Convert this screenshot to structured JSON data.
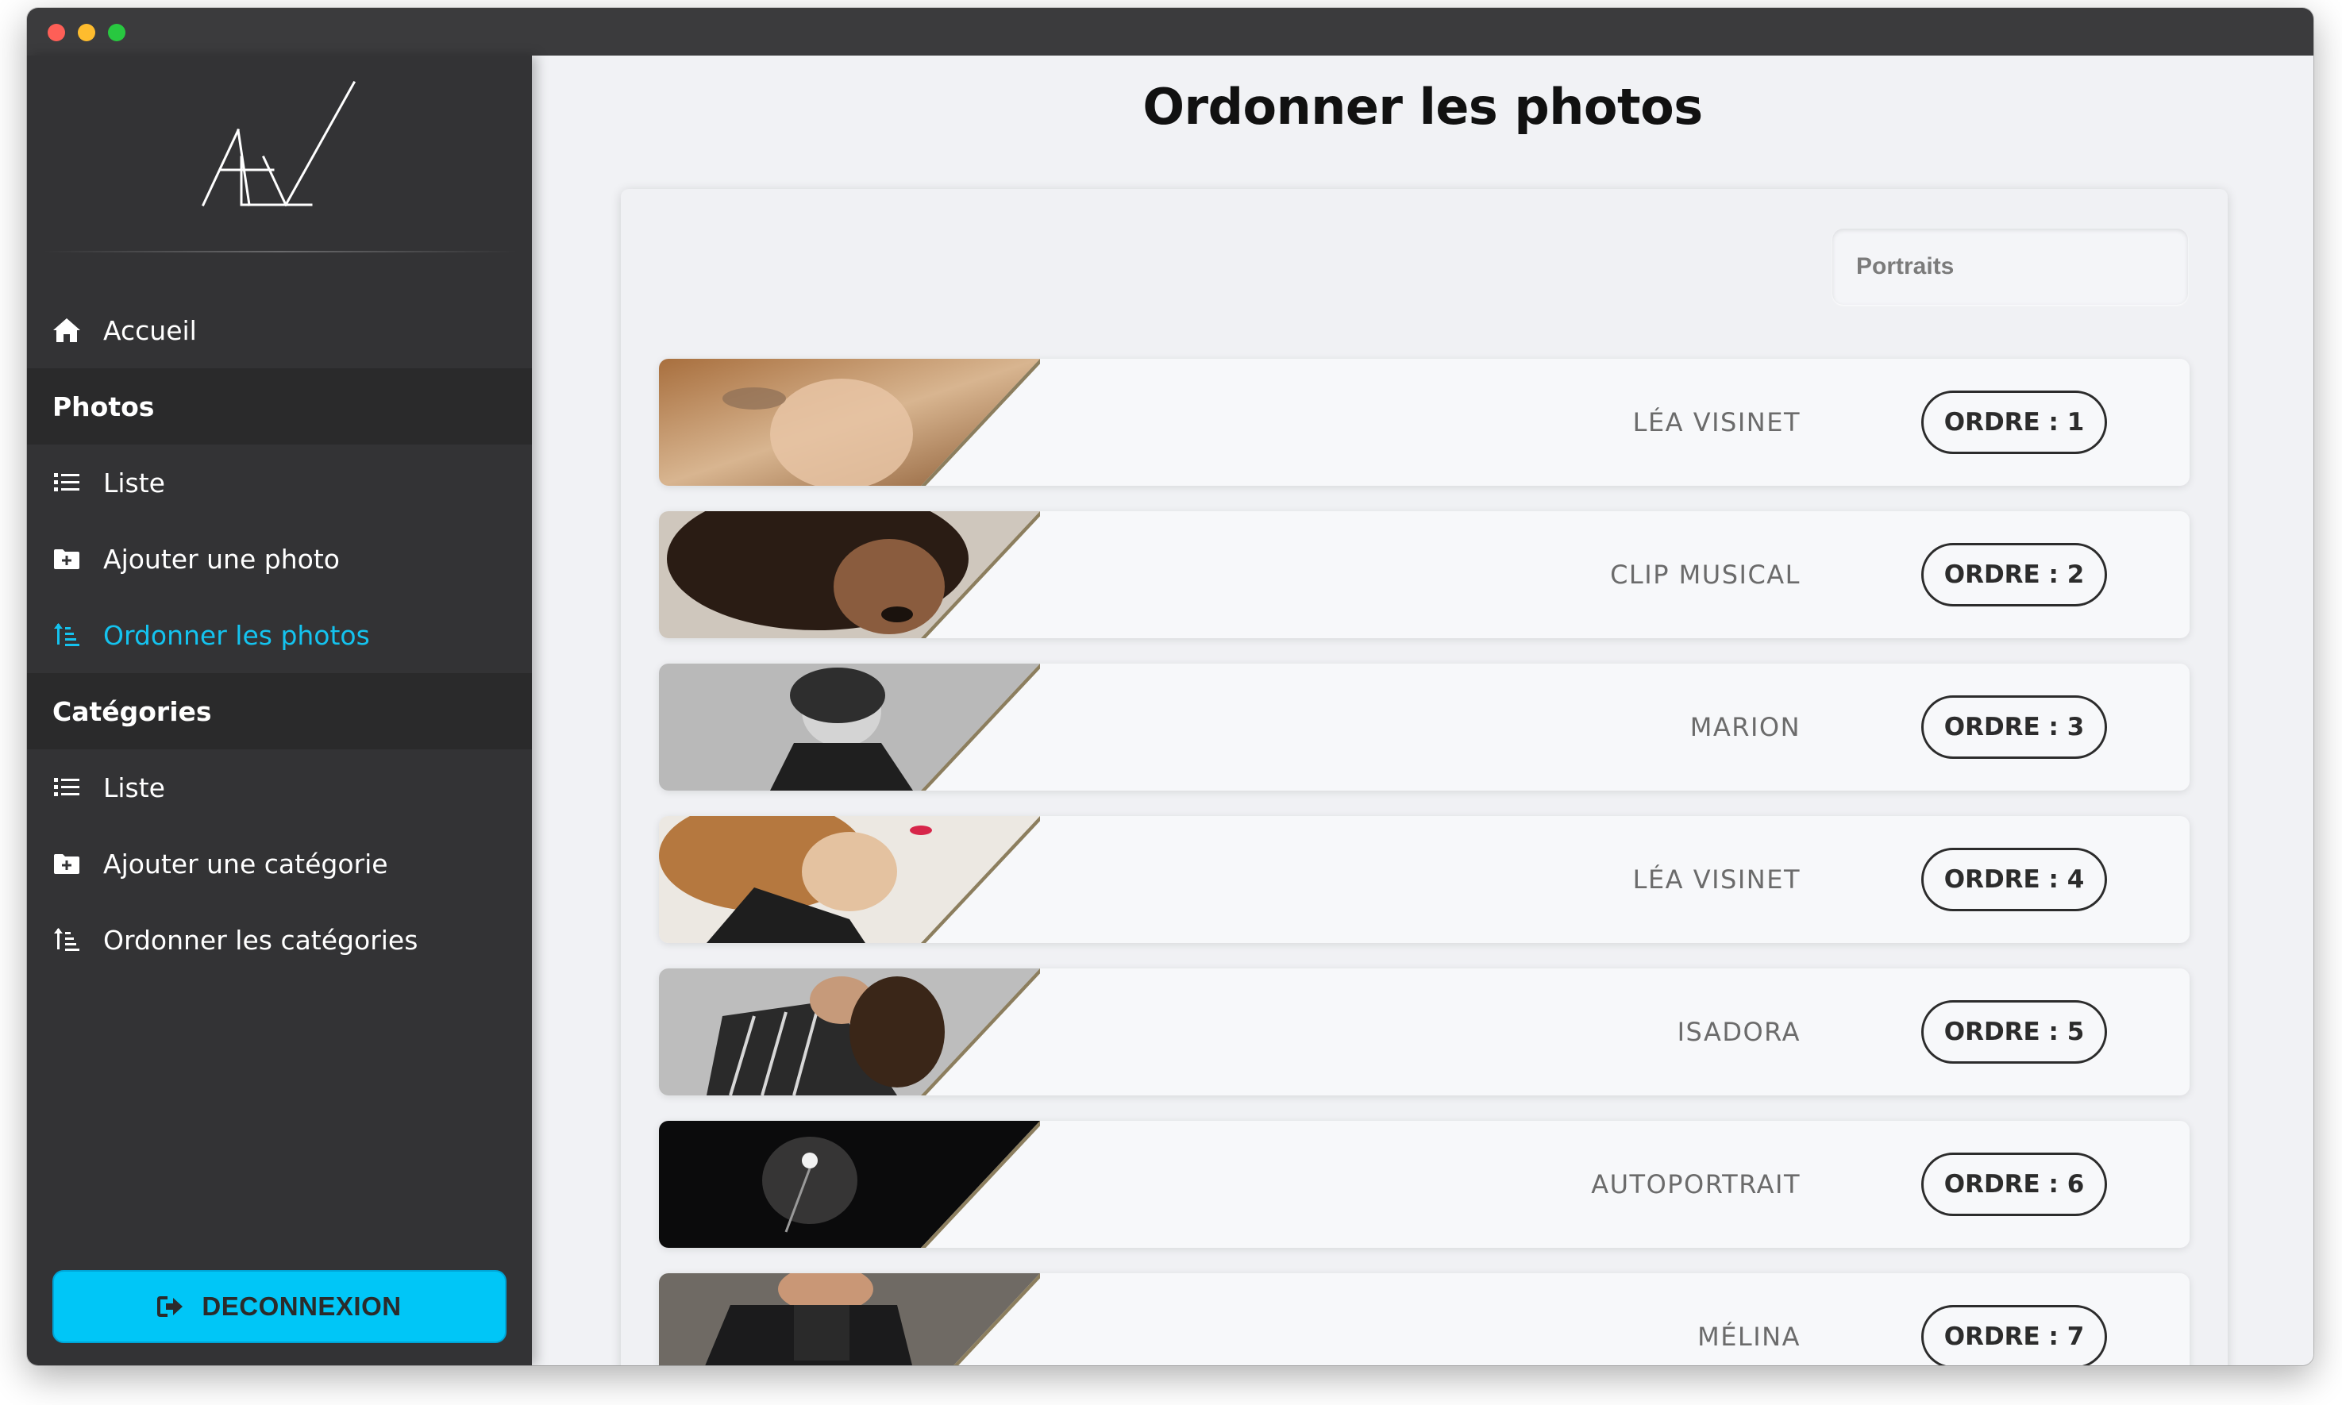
{
  "sidebar": {
    "nav": {
      "accueil": "Accueil",
      "photos_header": "Photos",
      "photos_liste": "Liste",
      "photos_ajouter": "Ajouter une photo",
      "photos_ordonner": "Ordonner les photos",
      "categories_header": "Catégories",
      "categories_liste": "Liste",
      "categories_ajouter": "Ajouter une catégorie",
      "categories_ordonner": "Ordonner les catégories"
    },
    "active_item": "Ordonner les photos",
    "logout_label": "DECONNEXION"
  },
  "main": {
    "title": "Ordonner les photos",
    "category_select": "Portraits",
    "rows": [
      {
        "name": "LÉA VISINET",
        "order": "ORDRE : 1"
      },
      {
        "name": "CLIP MUSICAL",
        "order": "ORDRE : 2"
      },
      {
        "name": "MARION",
        "order": "ORDRE : 3"
      },
      {
        "name": "LÉA VISINET",
        "order": "ORDRE : 4"
      },
      {
        "name": "ISADORA",
        "order": "ORDRE : 5"
      },
      {
        "name": "AUTOPORTRAIT",
        "order": "ORDRE : 6"
      },
      {
        "name": "MÉLINA",
        "order": "ORDRE : 7"
      }
    ]
  },
  "colors": {
    "sidebar_bg": "#333335",
    "section_bg": "#2a2a2b",
    "accent": "#14c3ef",
    "logout_bg": "#00c6f7",
    "content_bg": "#f1f2f5"
  },
  "icons": {
    "accueil": "home-icon",
    "liste": "list-icon",
    "ajouter": "folder-plus-icon",
    "ordonner": "sort-order-icon",
    "logout": "sign-out-icon"
  }
}
